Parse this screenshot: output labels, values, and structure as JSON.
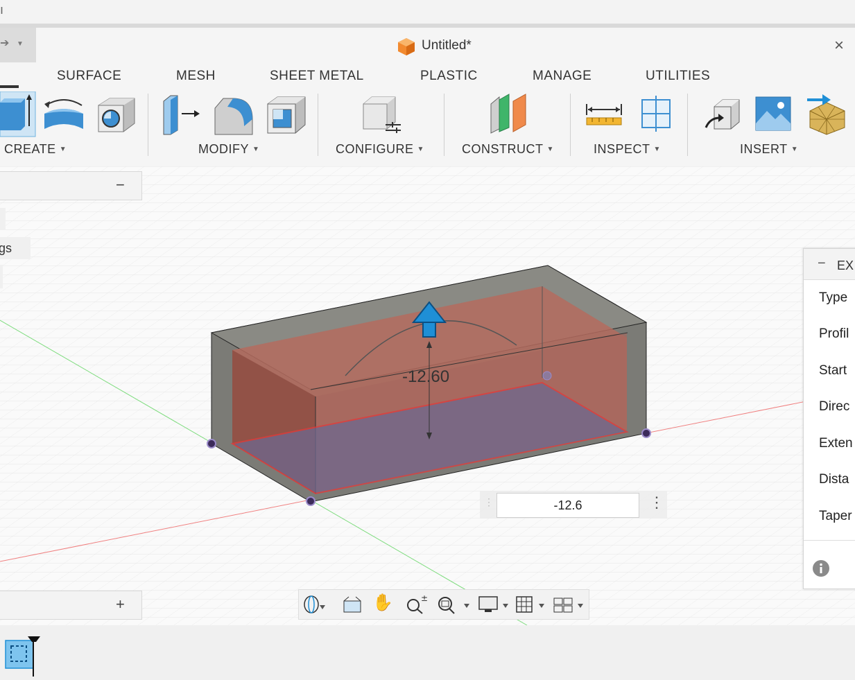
{
  "window": {
    "title": "Untitled*",
    "close_glyph": "×"
  },
  "ribbon": {
    "tabs": [
      "SURFACE",
      "MESH",
      "SHEET METAL",
      "PLASTIC",
      "MANAGE",
      "UTILITIES"
    ],
    "groups": {
      "create": "CREATE",
      "modify": "MODIFY",
      "configure": "CONFIGURE",
      "construct": "CONSTRUCT",
      "inspect": "INSPECT",
      "insert": "INSERT"
    }
  },
  "browser": {
    "partial_label": "gs",
    "collapse_glyph": "−",
    "expand_glyph": "+"
  },
  "viewport": {
    "dimension_label": "-12.60"
  },
  "dimension_input": {
    "value": "-12.6"
  },
  "extrude_panel": {
    "title": "EX",
    "collapse_glyph": "−",
    "rows": [
      "Type",
      "Profil",
      "Start",
      "Direc",
      "Exten",
      "Dista",
      "Taper"
    ]
  },
  "colors": {
    "accent_blue": "#1f8fd6",
    "profile_red": "#e23a3a",
    "body_grey": "#7b7b76",
    "extrude_fill": "#b46b5e"
  },
  "icons": [
    "app-cube-icon",
    "close-icon",
    "extrude-icon",
    "revolve-icon",
    "hole-icon",
    "press-pull-icon",
    "fillet-icon",
    "shell-icon",
    "configure-icon",
    "plane-icon",
    "measure-icon",
    "section-icon",
    "insert-derive-icon",
    "insert-image-icon",
    "insert-mesh-icon",
    "orbit-icon",
    "look-at-icon",
    "pan-icon",
    "zoom-icon",
    "fit-icon",
    "display-icon",
    "grid-icon",
    "viewports-icon",
    "info-icon",
    "select-icon"
  ]
}
